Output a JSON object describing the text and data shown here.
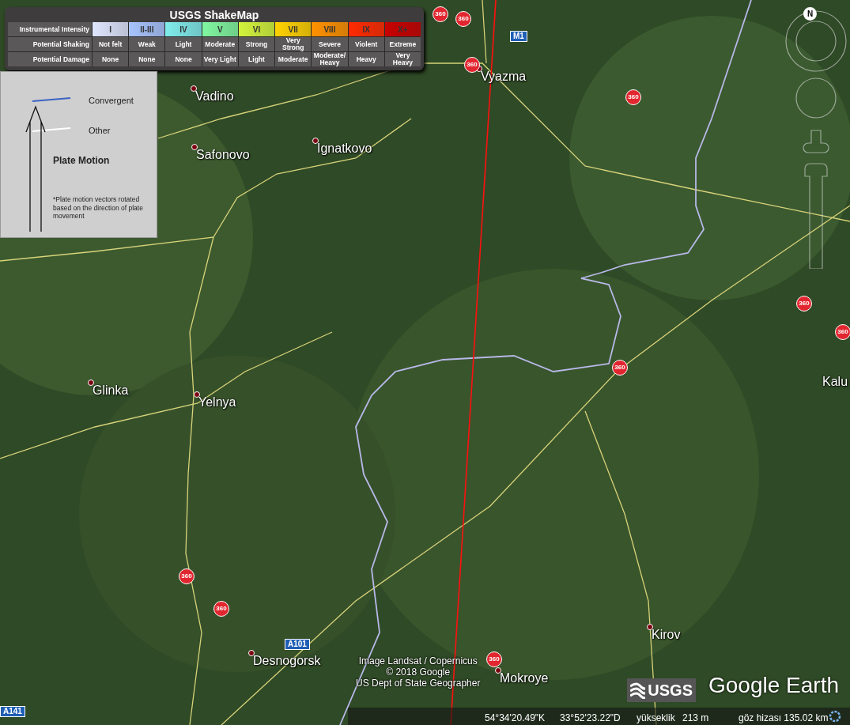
{
  "shakemap": {
    "title": "USGS ShakeMap",
    "row_labels": [
      "Instrumental Intensity",
      "Potential Shaking",
      "Potential Damage"
    ],
    "columns": [
      {
        "intensity": "I",
        "shaking": "Not felt",
        "damage": "None",
        "color": "#dfe6ff"
      },
      {
        "intensity": "II-III",
        "shaking": "Weak",
        "damage": "None",
        "color": "#a8c4ff"
      },
      {
        "intensity": "IV",
        "shaking": "Light",
        "damage": "None",
        "color": "#80ecec"
      },
      {
        "intensity": "V",
        "shaking": "Moderate",
        "damage": "Very Light",
        "color": "#80f7a0"
      },
      {
        "intensity": "VI",
        "shaking": "Strong",
        "damage": "Light",
        "color": "#d2f53c"
      },
      {
        "intensity": "VII",
        "shaking": "Very Strong",
        "damage": "Moderate",
        "color": "#ffd200"
      },
      {
        "intensity": "VIII",
        "shaking": "Severe",
        "damage": "Moderate/ Heavy",
        "color": "#ff9100"
      },
      {
        "intensity": "IX",
        "shaking": "Violent",
        "damage": "Heavy",
        "color": "#ff2a00"
      },
      {
        "intensity": "X+",
        "shaking": "Extreme",
        "damage": "Very Heavy",
        "color": "#c80000"
      }
    ]
  },
  "plate_legend": {
    "boundaries": [
      {
        "label": "Convergent",
        "color": "#3a63c4"
      },
      {
        "label": "Other",
        "color": "#ffffff"
      }
    ],
    "title": "Plate Motion",
    "note": "*Plate motion vectors rotated based on the direction of plate movement"
  },
  "compass": {
    "label": "N"
  },
  "places": [
    "Vadino",
    "Safonovo",
    "Ignatkovo",
    "Vyazma",
    "Glinka",
    "Yelnya",
    "Desnogorsk",
    "Mokroye",
    "Kirov",
    "Kalu"
  ],
  "road_shields": [
    "M1",
    "A101",
    "A141"
  ],
  "panorama_markers": [
    "360",
    "360",
    "360",
    "360",
    "360",
    "360",
    "360",
    "360",
    "360",
    "360"
  ],
  "attribution": [
    "Image Landsat / Copernicus",
    "© 2018 Google",
    "US Dept of State Geographer"
  ],
  "logos": {
    "usgs": "USGS",
    "google_earth": "Google Earth"
  },
  "status_bar": {
    "latitude": "54°34'20.49\"K",
    "longitude": "33°52'23.22\"D",
    "elevation_label": "yükseklik",
    "elevation": "213 m",
    "eye_altitude": "göz hizası 135.02 km"
  }
}
